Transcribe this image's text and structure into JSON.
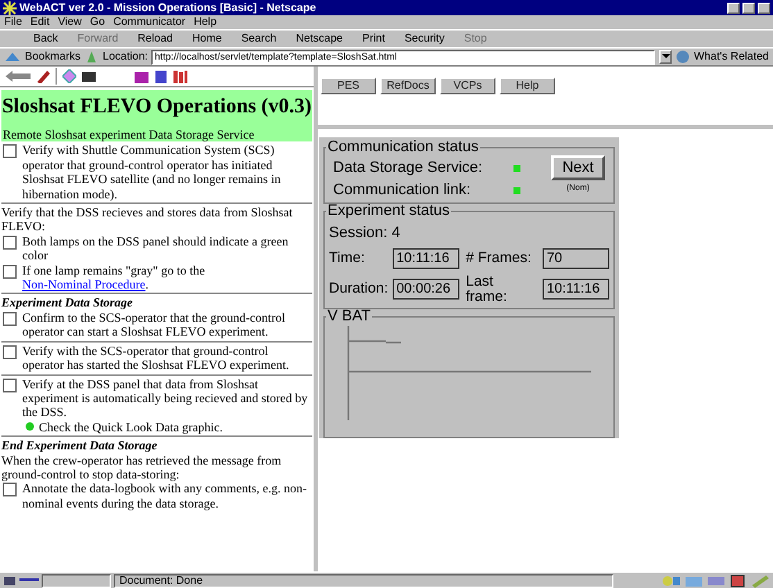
{
  "window": {
    "title": "WebACT ver 2.0 - Mission Operations [Basic] - Netscape"
  },
  "menu": [
    "File",
    "Edit",
    "View",
    "Go",
    "Communicator",
    "Help"
  ],
  "toolbar": [
    {
      "label": "Back",
      "disabled": false
    },
    {
      "label": "Forward",
      "disabled": true
    },
    {
      "label": "Reload",
      "disabled": false
    },
    {
      "label": "Home",
      "disabled": false
    },
    {
      "label": "Search",
      "disabled": false
    },
    {
      "label": "Netscape",
      "disabled": false
    },
    {
      "label": "Print",
      "disabled": false
    },
    {
      "label": "Security",
      "disabled": false
    },
    {
      "label": "Stop",
      "disabled": true
    }
  ],
  "location_bar": {
    "bookmarks": "Bookmarks",
    "label": "Location:",
    "url": "http://localhost/servlet/template?template=SloshSat.html",
    "related": "What's Related"
  },
  "procedure": {
    "title": "Sloshsat FLEVO Operations (v0.3)",
    "subtitle": "Remote Sloshsat experiment Data Storage Service",
    "sections": [
      [
        {
          "kind": "check",
          "text": "Verify with Shuttle Communication System (SCS) operator that ground-control operator has initiated Sloshsat FLEVO satellite (and no longer remains in hibernation mode).",
          "checked": false
        }
      ],
      [
        {
          "kind": "text",
          "text": "Verify that the DSS recieves and stores data from Sloshsat FLEVO:"
        },
        {
          "kind": "check",
          "text": "Both lamps on the DSS panel should indicate a green color",
          "checked": false
        },
        {
          "kind": "check",
          "text": "If one lamp remains \"gray\" go to the ",
          "link": "Non-Nominal Procedure",
          "after": ".",
          "checked": false
        }
      ],
      [
        {
          "kind": "heading",
          "text": "Experiment Data Storage"
        },
        {
          "kind": "check",
          "text": "Confirm to the SCS-operator that the ground-control operator can start a Sloshsat FLEVO experiment.",
          "checked": false
        }
      ],
      [
        {
          "kind": "check",
          "text": "Verify with the SCS-operator that ground-control operator has started the Sloshsat FLEVO experiment.",
          "checked": false
        }
      ],
      [
        {
          "kind": "check",
          "text": "Verify at the DSS panel that data from Sloshsat experiment is automatically being recieved and stored by the DSS.",
          "note": "Check the Quick Look Data graphic.",
          "checked": false
        }
      ],
      [
        {
          "kind": "heading",
          "text": "End Experiment Data Storage"
        },
        {
          "kind": "text",
          "text": "When the crew-operator has retrieved the message from ground-control to stop data-storing:"
        },
        {
          "kind": "check",
          "text": "Annotate the data-logbook with any comments, e.g. non-nominal events during the data storage.",
          "checked": false
        }
      ]
    ]
  },
  "nav_buttons": [
    "PES",
    "RefDocs",
    "VCPs",
    "Help"
  ],
  "panel": {
    "communication": {
      "title": "Communication status",
      "lamps": [
        {
          "label": "Data Storage Service:",
          "on": true
        },
        {
          "label": "Communication link:",
          "on": true
        }
      ],
      "next_button": "Next",
      "mode": "(Nom)"
    },
    "experiment": {
      "title": "Experiment status",
      "session": "Session: 4",
      "fields": [
        {
          "label": "Time:",
          "value": "10:11:16"
        },
        {
          "label": "# Frames:",
          "value": "70"
        },
        {
          "label": "Duration:",
          "value": "00:00:26"
        },
        {
          "label": "Last frame:",
          "value": "10:11:16"
        }
      ]
    },
    "graph": {
      "title": "V BAT"
    }
  },
  "status_bar": {
    "text": "Document: Done"
  }
}
